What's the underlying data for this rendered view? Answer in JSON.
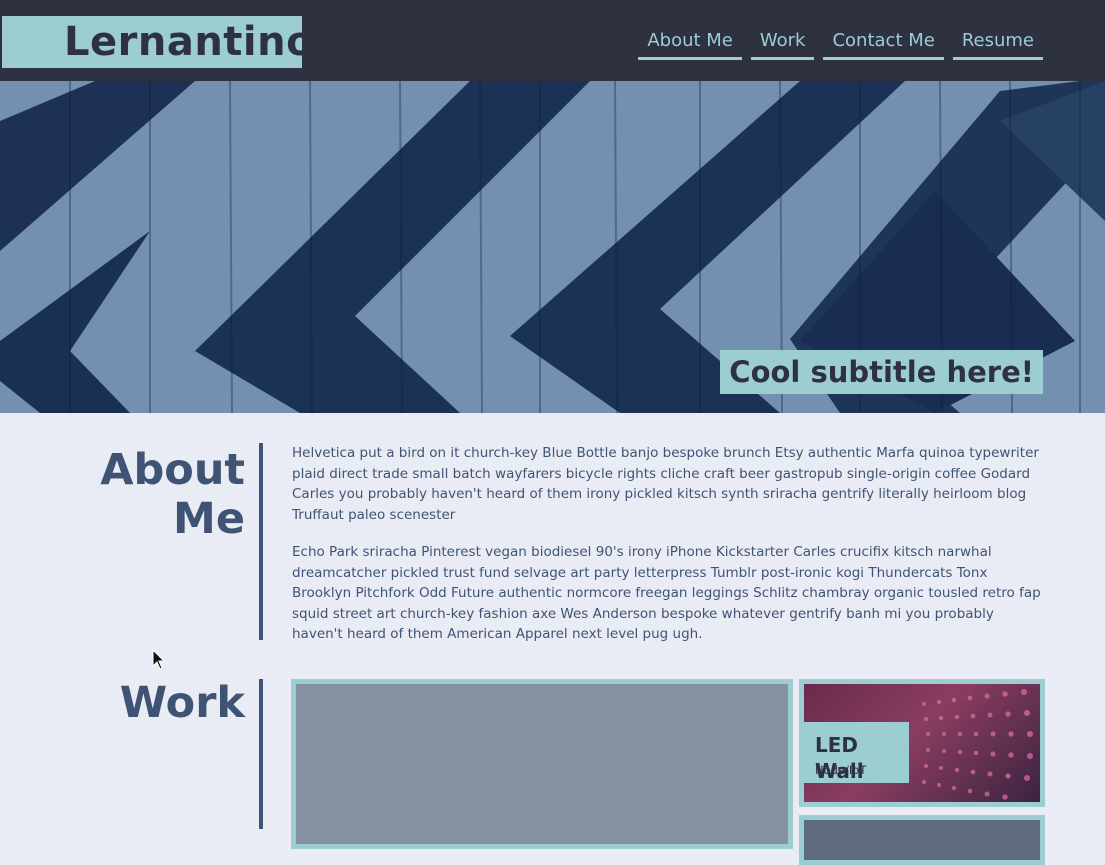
{
  "header": {
    "logo": "Lernantino",
    "nav": [
      "About Me",
      "Work",
      "Contact Me",
      "Resume"
    ]
  },
  "hero": {
    "subtitle": "Cool subtitle here!"
  },
  "about": {
    "title_line1": "About",
    "title_line2": "Me",
    "paragraphs": [
      "Helvetica put a bird on it church-key Blue Bottle banjo bespoke brunch Etsy authentic Marfa quinoa typewriter plaid direct trade small batch wayfarers bicycle rights cliche craft beer gastropub single-origin coffee Godard Carles you probably haven't heard of them irony pickled kitsch synth sriracha gentrify literally heirloom blog Truffaut paleo scenester",
      "Echo Park sriracha Pinterest vegan biodiesel 90's irony iPhone Kickstarter Carles crucifix kitsch narwhal dreamcatcher pickled trust fund selvage art party letterpress Tumblr post-ironic kogi Thundercats Tonx Brooklyn Pitchfork Odd Future authentic normcore freegan leggings Schlitz chambray organic tousled retro fap squid street art church-key fashion axe Wes Anderson bespoke whatever gentrify banh mi you probably haven't heard of them American Apparel next level pug ugh."
    ]
  },
  "work": {
    "title": "Work",
    "cards": [
      {
        "title": "LED Wall",
        "subtitle": "Node/IoT"
      }
    ]
  },
  "colors": {
    "header_bg": "#2d3140",
    "accent": "#9ccdd0",
    "text": "#3f5474",
    "page_bg": "#e9ecf4"
  }
}
